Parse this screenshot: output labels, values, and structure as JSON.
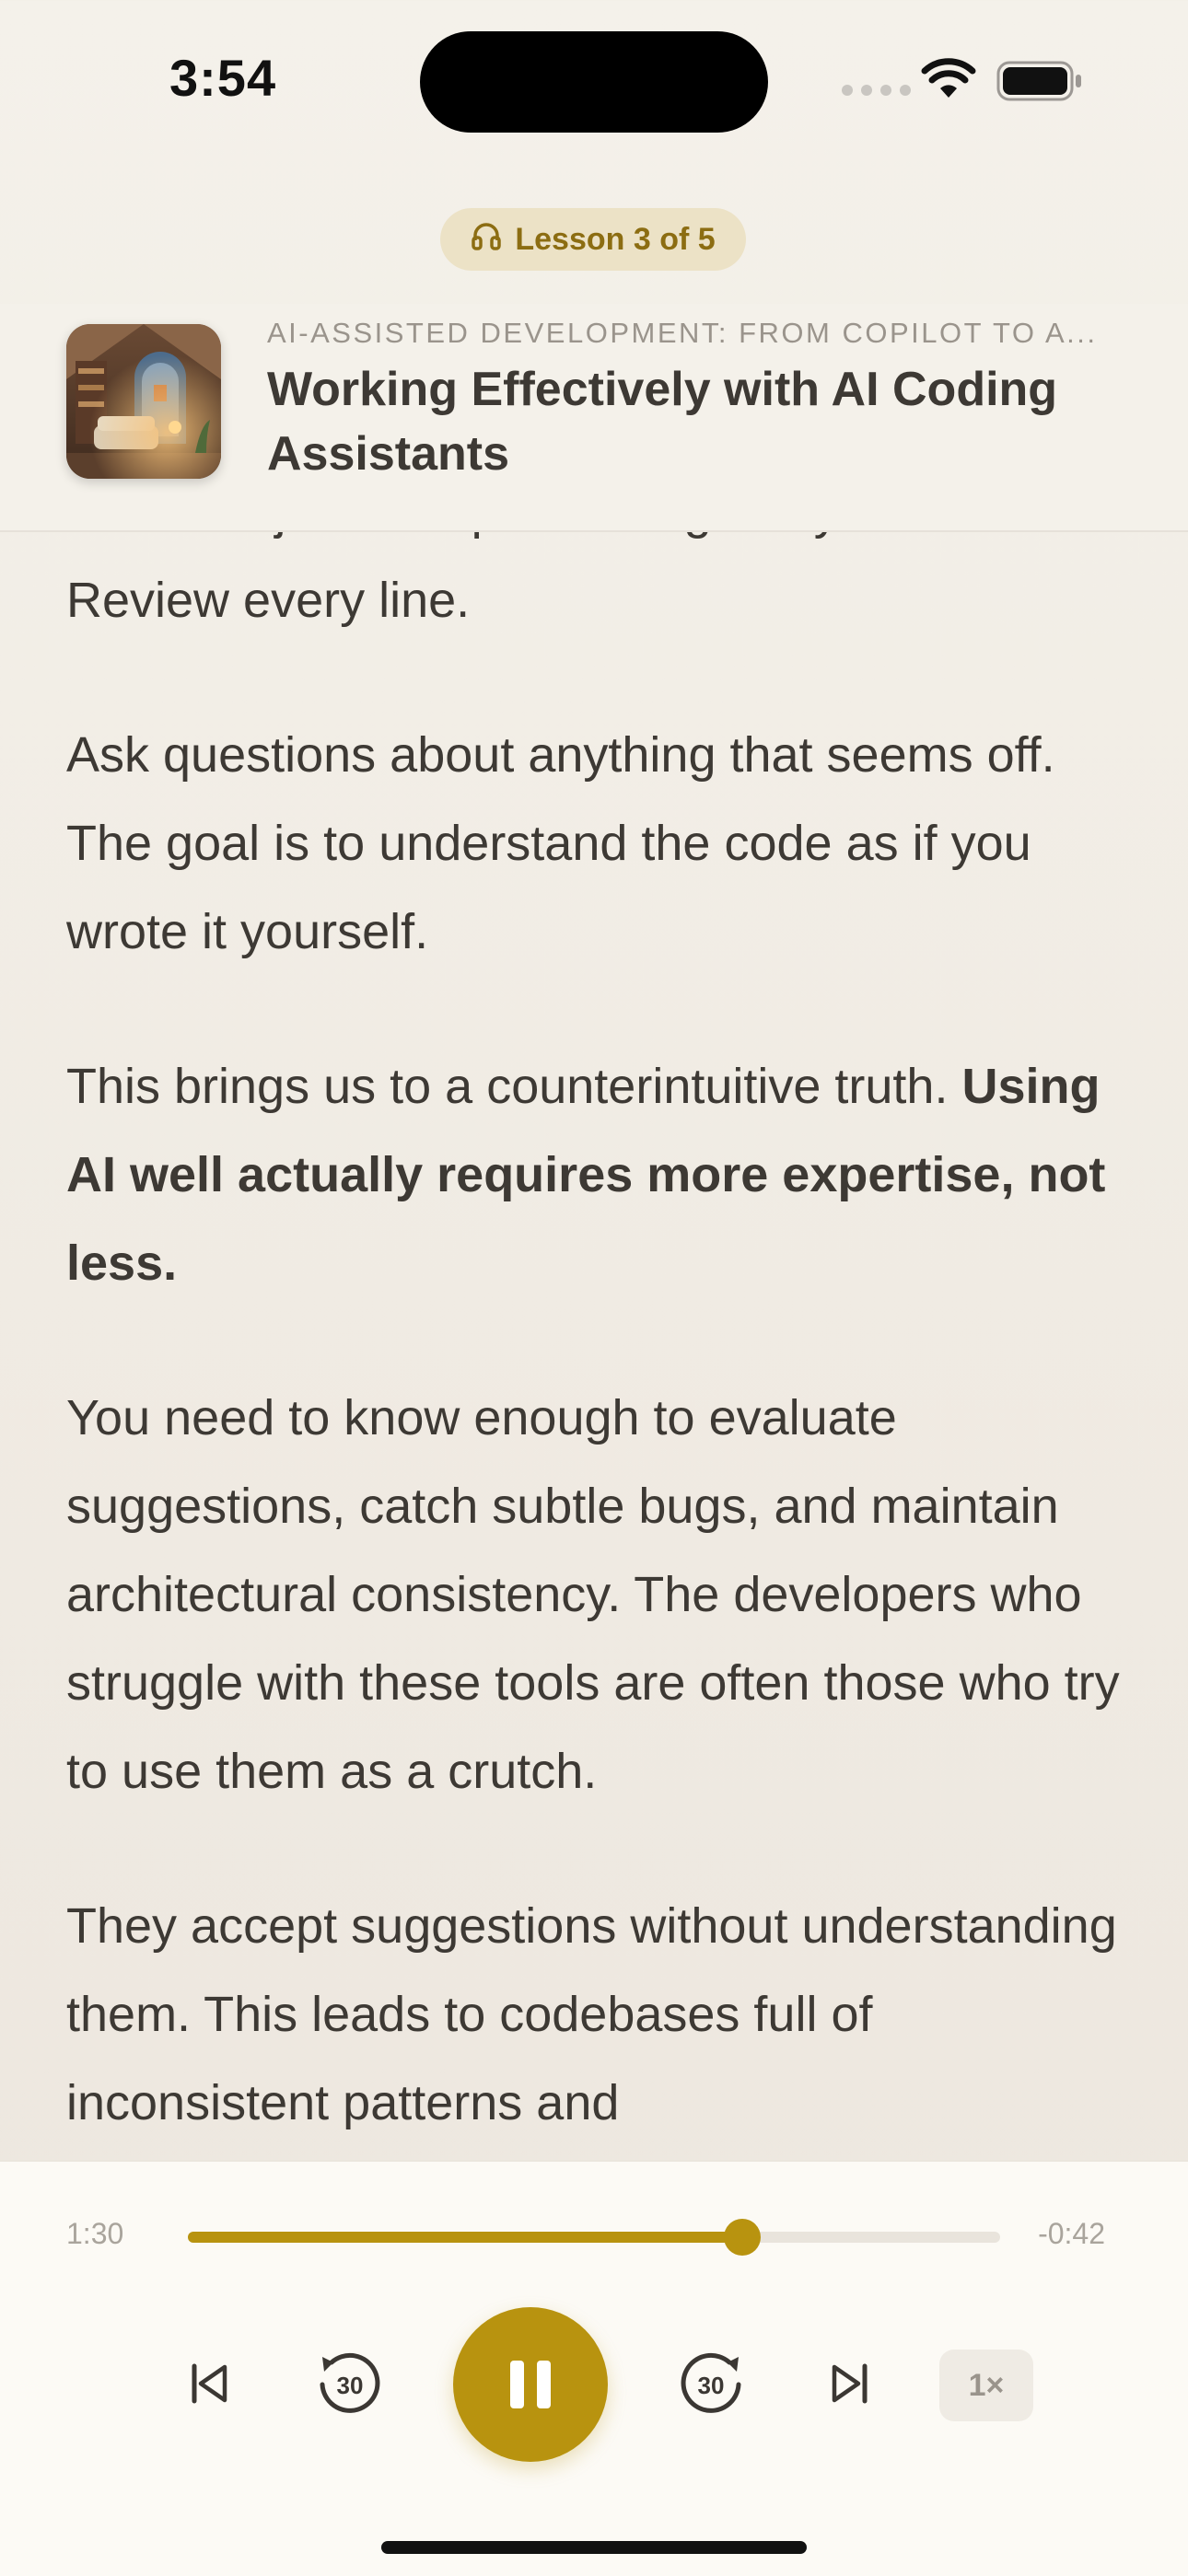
{
  "status_bar": {
    "time": "3:54"
  },
  "header": {
    "lesson_badge": "Lesson 3 of 5",
    "course_title": "AI-ASSISTED DEVELOPMENT: FROM COPILOT TO A...",
    "lesson_title": "Working Effectively with AI Coding Assistants"
  },
  "transcript": {
    "partial_top": "But don't just accept what it gives you.",
    "p0": "Review every line.",
    "p1": "Ask questions about anything that seems off. The goal is to understand the code as if you wrote it yourself.",
    "p2_plain": "This brings us to a counterintuitive truth.",
    "p2_bold": "Using AI well actually requires more expertise, not less.",
    "p3": "You need to know enough to evaluate suggestions, catch subtle bugs, and maintain architectural consistency. The developers who struggle with these tools are often those who try to use them as a crutch.",
    "p4": "They accept suggestions without understanding them. This leads to codebases full of inconsistent patterns and"
  },
  "player": {
    "elapsed": "1:30",
    "remaining": "-0:42",
    "progress_fraction": 0.682,
    "skip_back_seconds": "30",
    "skip_forward_seconds": "30",
    "speed": "1×",
    "accent_color": "#b8930f"
  },
  "icons": {
    "lesson_badge": "headphones-icon",
    "previous": "skip-previous-icon",
    "rewind": "rewind-30-icon",
    "play_pause": "pause-icon",
    "forward": "forward-30-icon",
    "next": "skip-next-icon"
  }
}
